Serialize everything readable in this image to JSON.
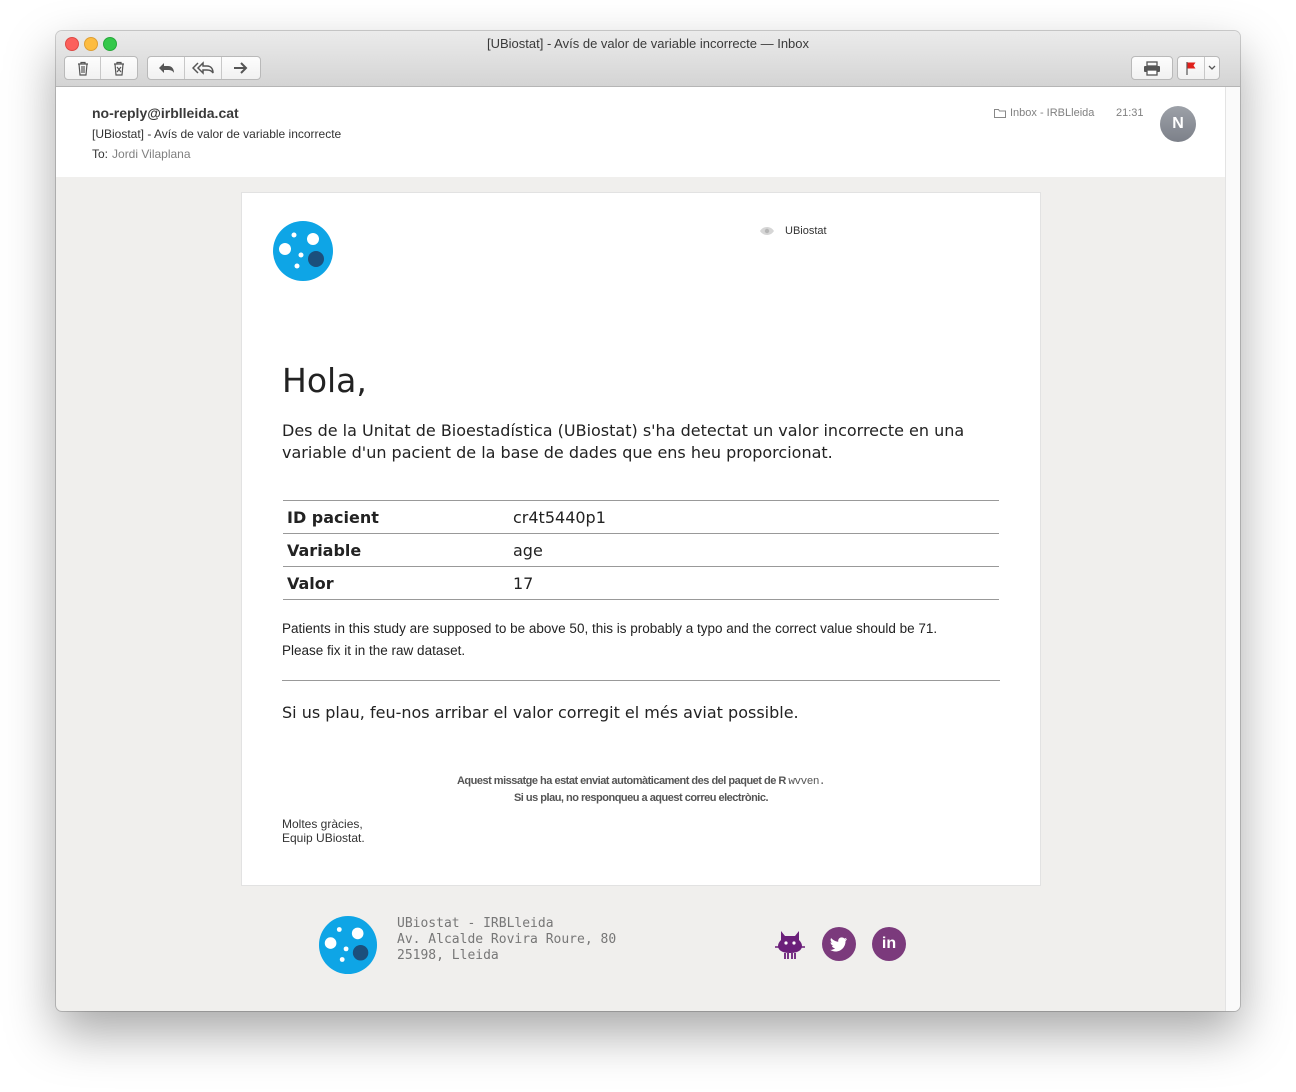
{
  "window": {
    "title": "[UBiostat]  - Avís de valor de variable incorrecte — Inbox"
  },
  "header": {
    "from": "no-reply@irblleida.cat",
    "subject": "[UBiostat]  - Avís de valor de variable incorrecte",
    "to_label": "To:",
    "to_name": "Jordi Vilaplana",
    "mailbox": "Inbox - IRBLleida",
    "time": "21:31",
    "avatar_initial": "N"
  },
  "email": {
    "brand_label": "UBiostat",
    "greeting": "Hola,",
    "intro": "Des de la Unitat de Bioestadística (UBiostat) s'ha detectat un valor incorrecte en una variable d'un pacient de la base de dades que ens heu proporcionat.",
    "table": [
      {
        "key": "ID pacient",
        "value": "cr4t5440p1"
      },
      {
        "key": "Variable",
        "value": "age"
      },
      {
        "key": "Valor",
        "value": "17"
      }
    ],
    "note_line1": "Patients in this study are supposed to be above 50, this is probably a typo and the correct value should be 71.",
    "note_line2": "Please fix it in the raw dataset.",
    "closing": "Si us plau, feu-nos arribar el valor corregit el més aviat possible.",
    "auto_line1": "Aquest missatge ha estat enviat automàticament des del paquet de R",
    "auto_pkg": "wvven.",
    "auto_line2": "Si us plau, no responqueu a aquest correu electrònic.",
    "thanks_line1": "Moltes gràcies,",
    "thanks_line2": "Equip UBiostat."
  },
  "footer": {
    "org": "UBiostat - IRBLleida",
    "street": "Av. Alcalde Rovira Roure, 80",
    "city": "25198, Lleida",
    "linkedin_text": "in"
  },
  "icons": {
    "toolbar": [
      "trash-icon",
      "junk-icon",
      "reply-icon",
      "reply-all-icon",
      "forward-icon",
      "print-icon",
      "flag-icon",
      "chevron-down-icon"
    ],
    "social": [
      "github-icon",
      "twitter-icon",
      "linkedin-icon"
    ]
  },
  "colors": {
    "logo_blue": "#0ea5e6",
    "logo_dark": "#1b4f7c",
    "social_purple": "#7b3a7c",
    "flag_red": "#e0201b"
  }
}
